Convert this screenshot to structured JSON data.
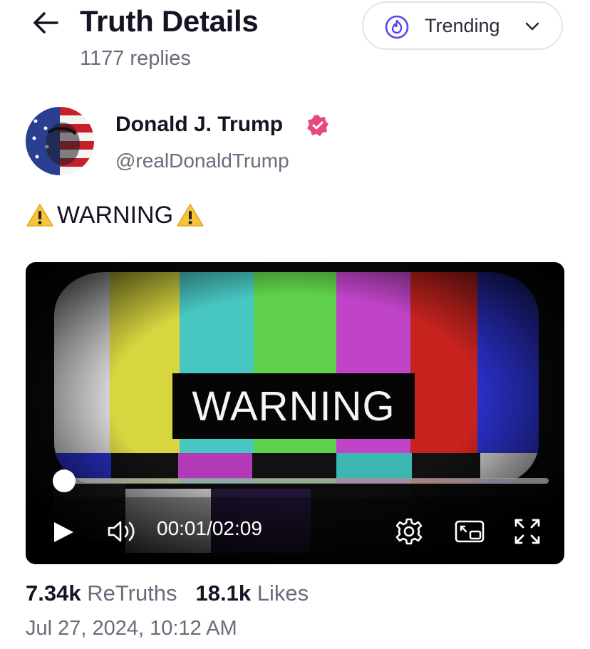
{
  "header": {
    "title": "Truth Details",
    "replies": "1177 replies"
  },
  "sort": {
    "label": "Trending",
    "icon": "flame-icon",
    "accent": "#5448ee"
  },
  "post": {
    "author_name": "Donald J. Trump",
    "author_handle": "@realDonaldTrump",
    "verified_color": "#e44a7c",
    "text_prefix_icon": "warning-icon",
    "text": "WARNING",
    "text_suffix_icon": "warning-icon",
    "video": {
      "caption": "WARNING",
      "current_time": "00:01",
      "separator": "/",
      "duration": "02:09",
      "progress": 0.008
    },
    "retruths_count": "7.34k",
    "retruths_label": "ReTruths",
    "likes_count": "18.1k",
    "likes_label": "Likes",
    "timestamp": "Jul 27, 2024, 10:12 AM"
  }
}
